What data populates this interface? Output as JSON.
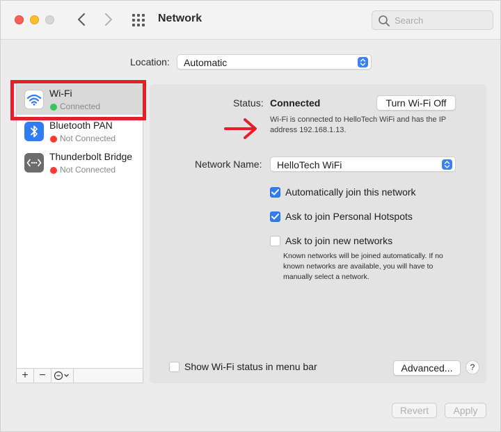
{
  "window": {
    "title": "Network",
    "search_placeholder": "Search"
  },
  "location": {
    "label": "Location:",
    "value": "Automatic"
  },
  "sidebar": {
    "items": [
      {
        "name": "Wi-Fi",
        "status": "Connected",
        "status_color": "#34c759",
        "icon": "wifi-icon",
        "selected": true
      },
      {
        "name": "Bluetooth PAN",
        "status": "Not Connected",
        "status_color": "#ff3b30",
        "icon": "bluetooth-icon",
        "selected": false
      },
      {
        "name": "Thunderbolt Bridge",
        "status": "Not Connected",
        "status_color": "#ff3b30",
        "icon": "thunderbolt-bridge-icon",
        "selected": false
      }
    ],
    "footer": {
      "add": "+",
      "remove": "−"
    }
  },
  "main": {
    "status_label": "Status:",
    "status_value": "Connected",
    "turn_off_button": "Turn Wi-Fi Off",
    "description": "Wi-Fi is connected to HelloTech WiFi and has the IP address 192.168.1.13.",
    "network_name_label": "Network Name:",
    "network_name_value": "HelloTech WiFi",
    "options": [
      {
        "label": "Automatically join this network",
        "checked": true
      },
      {
        "label": "Ask to join Personal Hotspots",
        "checked": true
      },
      {
        "label": "Ask to join new networks",
        "checked": false
      }
    ],
    "note": "Known networks will be joined automatically. If no known networks are available, you will have to manually select a network.",
    "show_status_label": "Show Wi-Fi status in menu bar",
    "advanced_button": "Advanced...",
    "help_button": "?"
  },
  "footer": {
    "revert_button": "Revert",
    "apply_button": "Apply"
  },
  "colors": {
    "accent": "#2f7cf6",
    "highlight_box": "#e3202a",
    "annotation_arrow": "#e3202a"
  }
}
